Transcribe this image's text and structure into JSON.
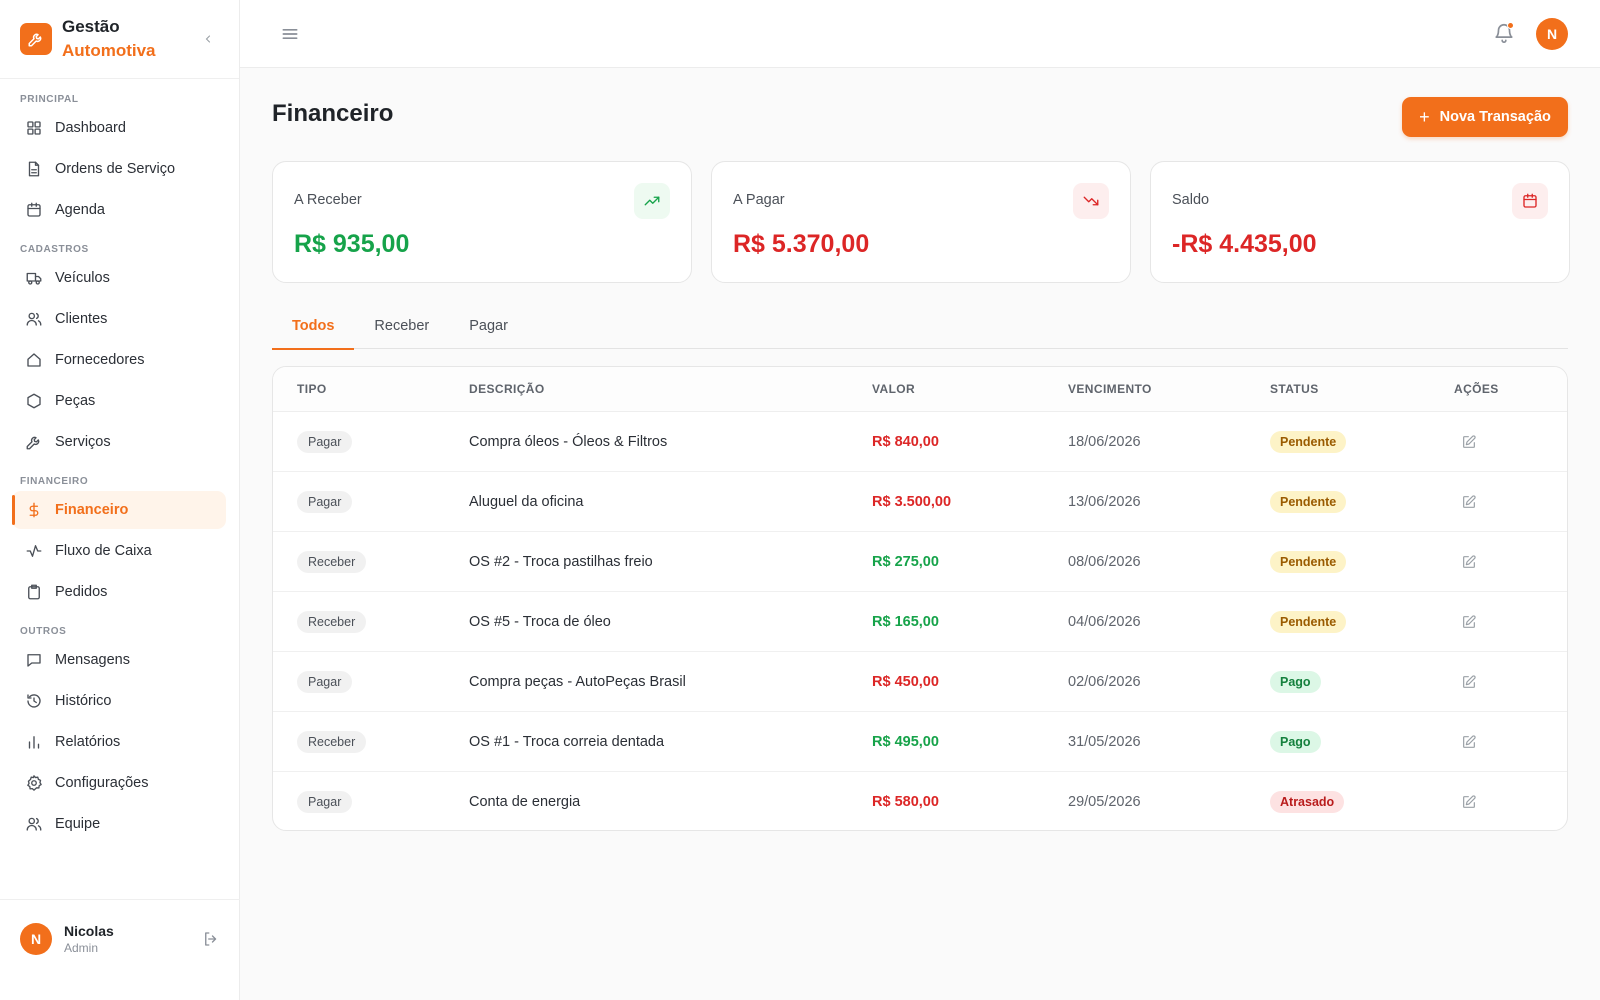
{
  "brand": {
    "line1": "Gestão",
    "line2": "Automotiva",
    "logo_icon": "wrench-icon"
  },
  "sidebar": {
    "sections": [
      {
        "label": "PRINCIPAL",
        "items": [
          {
            "label": "Dashboard",
            "icon": "grid-icon"
          },
          {
            "label": "Ordens de Serviço",
            "icon": "file-icon"
          },
          {
            "label": "Agenda",
            "icon": "calendar-icon"
          }
        ]
      },
      {
        "label": "CADASTROS",
        "items": [
          {
            "label": "Veículos",
            "icon": "truck-icon"
          },
          {
            "label": "Clientes",
            "icon": "users-icon"
          },
          {
            "label": "Fornecedores",
            "icon": "home-icon"
          },
          {
            "label": "Peças",
            "icon": "hexagon-icon"
          },
          {
            "label": "Serviços",
            "icon": "wrench-icon"
          }
        ]
      },
      {
        "label": "FINANCEIRO",
        "items": [
          {
            "label": "Financeiro",
            "icon": "dollar-icon",
            "active": true
          },
          {
            "label": "Fluxo de Caixa",
            "icon": "activity-icon"
          },
          {
            "label": "Pedidos",
            "icon": "clipboard-icon"
          }
        ]
      },
      {
        "label": "OUTROS",
        "items": [
          {
            "label": "Mensagens",
            "icon": "message-icon"
          },
          {
            "label": "Histórico",
            "icon": "history-icon"
          },
          {
            "label": "Relatórios",
            "icon": "bar-chart-icon"
          },
          {
            "label": "Configurações",
            "icon": "gear-icon"
          },
          {
            "label": "Equipe",
            "icon": "users-icon"
          }
        ]
      }
    ]
  },
  "user": {
    "initial": "N",
    "name": "Nicolas",
    "role": "Admin"
  },
  "topbar": {
    "avatar_initial": "N"
  },
  "page": {
    "title": "Financeiro",
    "new_button": "Nova Transação"
  },
  "cards": [
    {
      "label": "A Receber",
      "value": "R$ 935,00",
      "color": "#16a34a",
      "icon": "trending-up-icon",
      "icon_bg": "#eefaf1"
    },
    {
      "label": "A Pagar",
      "value": "R$ 5.370,00",
      "color": "#dc2626",
      "icon": "trending-down-icon",
      "icon_bg": "#fdeeee"
    },
    {
      "label": "Saldo",
      "value": "-R$ 4.435,00",
      "color": "#dc2626",
      "icon": "calendar-icon",
      "icon_bg": "#fdeeee"
    }
  ],
  "tabs": [
    {
      "label": "Todos",
      "active": true
    },
    {
      "label": "Receber",
      "active": false
    },
    {
      "label": "Pagar",
      "active": false
    }
  ],
  "table": {
    "headers": {
      "tipo": "TIPO",
      "descricao": "DESCRIÇÃO",
      "valor": "VALOR",
      "vencimento": "VENCIMENTO",
      "status": "STATUS",
      "acoes": "AÇÕES"
    },
    "rows": [
      {
        "tipo": "Pagar",
        "descricao": "Compra óleos - Óleos & Filtros",
        "valor": "R$ 840,00",
        "vencimento": "18/06/2026",
        "status": "Pendente"
      },
      {
        "tipo": "Pagar",
        "descricao": "Aluguel da oficina",
        "valor": "R$ 3.500,00",
        "vencimento": "13/06/2026",
        "status": "Pendente"
      },
      {
        "tipo": "Receber",
        "descricao": "OS #2 - Troca pastilhas freio",
        "valor": "R$ 275,00",
        "vencimento": "08/06/2026",
        "status": "Pendente"
      },
      {
        "tipo": "Receber",
        "descricao": "OS #5 - Troca de óleo",
        "valor": "R$ 165,00",
        "vencimento": "04/06/2026",
        "status": "Pendente"
      },
      {
        "tipo": "Pagar",
        "descricao": "Compra peças - AutoPeças Brasil",
        "valor": "R$ 450,00",
        "vencimento": "02/06/2026",
        "status": "Pago"
      },
      {
        "tipo": "Receber",
        "descricao": "OS #1 - Troca correia dentada",
        "valor": "R$ 495,00",
        "vencimento": "31/05/2026",
        "status": "Pago"
      },
      {
        "tipo": "Pagar",
        "descricao": "Conta de energia",
        "valor": "R$ 580,00",
        "vencimento": "29/05/2026",
        "status": "Atrasado"
      }
    ]
  },
  "colors": {
    "accent": "#f26f1b",
    "pagar": "#dc2626",
    "receber": "#16a34a",
    "status": {
      "Pendente": {
        "bg": "#fdf3c7",
        "fg": "#9a5b00"
      },
      "Pago": {
        "bg": "#dcf7e6",
        "fg": "#15803d"
      },
      "Atrasado": {
        "bg": "#fde2e2",
        "fg": "#b91c1c"
      }
    }
  }
}
